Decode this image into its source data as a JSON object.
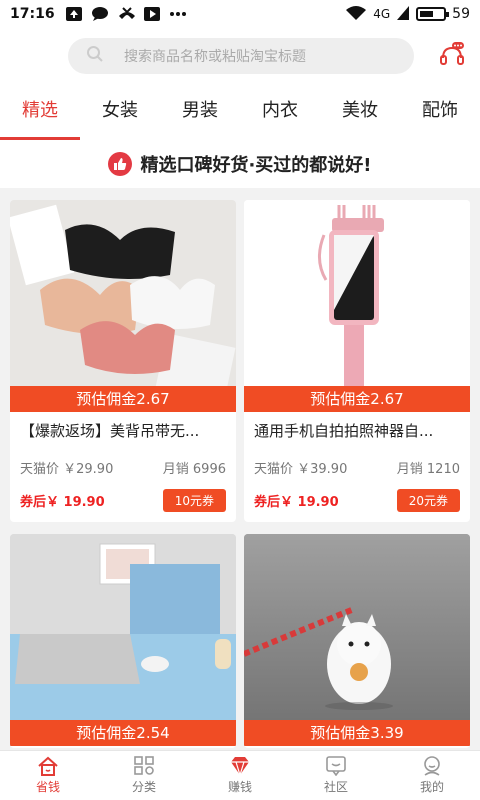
{
  "status_bar": {
    "time": "17:16",
    "network": "4G",
    "battery_level": "59",
    "battery_fraction": 0.59
  },
  "search": {
    "placeholder": "搜索商品名称或粘贴淘宝标题"
  },
  "tabs": [
    {
      "label": "精选",
      "active": true
    },
    {
      "label": "女装"
    },
    {
      "label": "男装"
    },
    {
      "label": "内衣"
    },
    {
      "label": "美妆"
    },
    {
      "label": "配饰"
    }
  ],
  "banner": {
    "text": "精选口碑好货·买过的都说好!"
  },
  "products": [
    {
      "commission": "预估佣金2.67",
      "title": "【爆款返场】美背吊带无...",
      "tmall_price": "天猫价 ￥29.90",
      "monthly_sales": "月销 6996",
      "after_coupon": "券后￥ 19.90",
      "coupon": "10元券"
    },
    {
      "commission": "预估佣金2.67",
      "title": "通用手机自拍拍照神器自...",
      "tmall_price": "天猫价 ￥39.90",
      "monthly_sales": "月销 1210",
      "after_coupon": "券后￥ 19.90",
      "coupon": "20元券"
    },
    {
      "commission": "预估佣金2.54"
    },
    {
      "commission": "预估佣金3.39"
    }
  ],
  "bottom_nav": [
    {
      "label": "省钱",
      "icon": "home-icon",
      "active": true
    },
    {
      "label": "分类",
      "icon": "grid-icon"
    },
    {
      "label": "赚钱",
      "icon": "diamond-icon"
    },
    {
      "label": "社区",
      "icon": "chat-icon"
    },
    {
      "label": "我的",
      "icon": "user-icon"
    }
  ],
  "colors": {
    "accent": "#e23c36",
    "commission_bg": "#f04c24"
  }
}
